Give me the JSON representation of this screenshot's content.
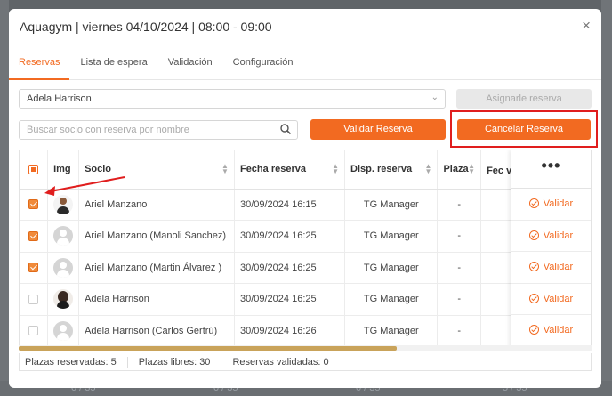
{
  "modal": {
    "title": "Aquagym | viernes 04/10/2024 | 08:00 - 09:00",
    "close_label": "×"
  },
  "tabs": [
    {
      "label": "Reservas",
      "active": true
    },
    {
      "label": "Lista de espera",
      "active": false
    },
    {
      "label": "Validación",
      "active": false
    },
    {
      "label": "Configuración",
      "active": false
    }
  ],
  "member_select": {
    "value": "Adela Harrison"
  },
  "assign_button": {
    "label": "Asignarle reserva"
  },
  "search": {
    "placeholder": "Buscar socio con reserva por nombre"
  },
  "validate_button": {
    "label": "Validar Reserva"
  },
  "cancel_button": {
    "label": "Cancelar Reserva"
  },
  "table": {
    "columns": [
      "Img",
      "Socio",
      "Fecha reserva",
      "Disp. reserva",
      "Plaza",
      "Fec val",
      "•••"
    ],
    "rows": [
      {
        "checked": true,
        "avatar": "photo-male",
        "socio": "Ariel Manzano",
        "fecha": "30/09/2024 16:15",
        "disp": "TG Manager",
        "plaza": "-",
        "action": "Validar"
      },
      {
        "checked": true,
        "avatar": "placeholder",
        "socio": "Ariel Manzano (Manoli Sanchez)",
        "fecha": "30/09/2024 16:25",
        "disp": "TG Manager",
        "plaza": "-",
        "action": "Validar"
      },
      {
        "checked": true,
        "avatar": "placeholder",
        "socio": "Ariel Manzano (Martin Álvarez )",
        "fecha": "30/09/2024 16:25",
        "disp": "TG Manager",
        "plaza": "-",
        "action": "Validar"
      },
      {
        "checked": false,
        "avatar": "photo-female",
        "socio": "Adela Harrison",
        "fecha": "30/09/2024 16:25",
        "disp": "TG Manager",
        "plaza": "-",
        "action": "Validar"
      },
      {
        "checked": false,
        "avatar": "placeholder",
        "socio": "Adela Harrison (Carlos Gertrú)",
        "fecha": "30/09/2024 16:26",
        "disp": "TG Manager",
        "plaza": "-",
        "action": "Validar"
      }
    ]
  },
  "footer": {
    "reserved": "Plazas reservadas: 5",
    "free": "Plazas libres: 30",
    "validated": "Reservas validadas: 0"
  },
  "horizontal_scroll_fraction": 0.66,
  "background_fragments": [
    "0 / 35",
    "0 / 35",
    "0 / 35",
    "5 / 35"
  ],
  "colors": {
    "accent": "#f26a21",
    "highlight_border": "#e01e1e",
    "annotation_arrow": "#e01e1e"
  }
}
